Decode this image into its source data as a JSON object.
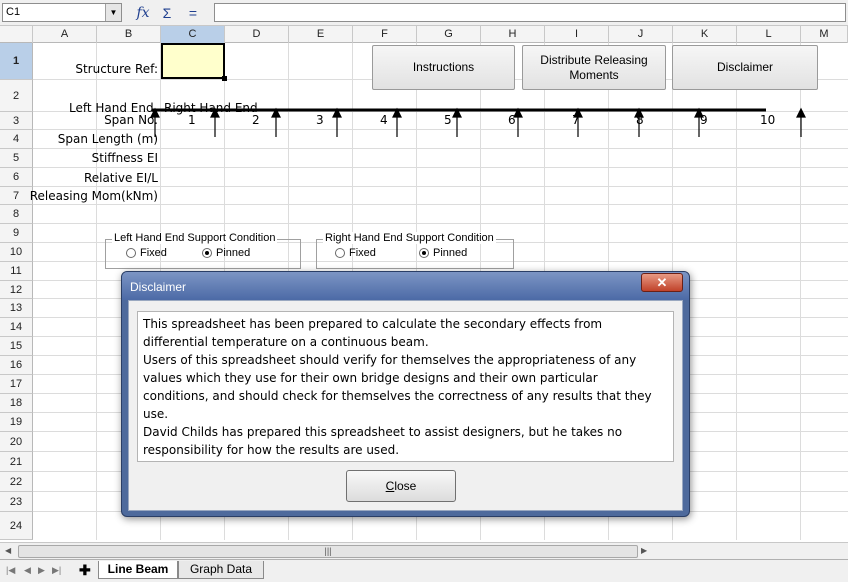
{
  "formula_bar": {
    "cell_ref": "C1",
    "function_wizard_icon": "fx-icon",
    "sum_icon": "sigma-icon",
    "equals_icon": "equals-icon",
    "formula": ""
  },
  "columns": [
    "A",
    "B",
    "C",
    "D",
    "E",
    "F",
    "G",
    "H",
    "I",
    "J",
    "K",
    "L",
    "M"
  ],
  "selected_column": "C",
  "rows": [
    "1",
    "2",
    "3",
    "4",
    "5",
    "6",
    "7",
    "8",
    "9",
    "10",
    "11",
    "12",
    "13",
    "14",
    "15",
    "16",
    "17",
    "18",
    "19",
    "20",
    "21",
    "22",
    "23",
    "24"
  ],
  "selected_row": "1",
  "labels": {
    "structure_ref": "Structure Ref:",
    "left_hand_end": "Left Hand End",
    "right_hand_end": "Right Hand End",
    "span_no": "Span No.",
    "span_length": "Span Length (m)",
    "stiffness": "Stiffness EI",
    "relative": "Relative EI/L",
    "releasing_mom": "Releasing Mom(kNm)"
  },
  "span_numbers": [
    "1",
    "2",
    "3",
    "4",
    "5",
    "6",
    "7",
    "8",
    "9",
    "10"
  ],
  "buttons": {
    "instructions": "Instructions",
    "distribute": "Distribute Releasing Moments",
    "disclaimer": "Disclaimer"
  },
  "support_groups": {
    "left": {
      "title": "Left Hand End Support Condition",
      "fixed": "Fixed",
      "pinned": "Pinned",
      "selected": "Pinned"
    },
    "right": {
      "title": "Right Hand End Support Condition",
      "fixed": "Fixed",
      "pinned": "Pinned",
      "selected": "Pinned"
    }
  },
  "sheet_tabs": {
    "add_icon": "add-sheet-icon",
    "tabs": [
      "Line Beam",
      "Graph Data"
    ],
    "active": "Line Beam"
  },
  "dialog": {
    "title": "Disclaimer",
    "close_glyph": "✕",
    "lines": [
      "This spreadsheet has been prepared to calculate the secondary effects from",
      "differential temperature on a continuous beam.",
      "Users of this spreadsheet should verify for themselves the appropriateness of any",
      "values which they use for their own bridge designs and their own particular",
      "conditions, and should check for themselves the correctness of any results that they",
      "use.",
      "David Childs has prepared this spreadsheet to assist designers, but he takes no",
      "responsibility for how the results are used."
    ],
    "button_label": "Close",
    "button_mnemonic": "C",
    "button_rest": "lose"
  }
}
